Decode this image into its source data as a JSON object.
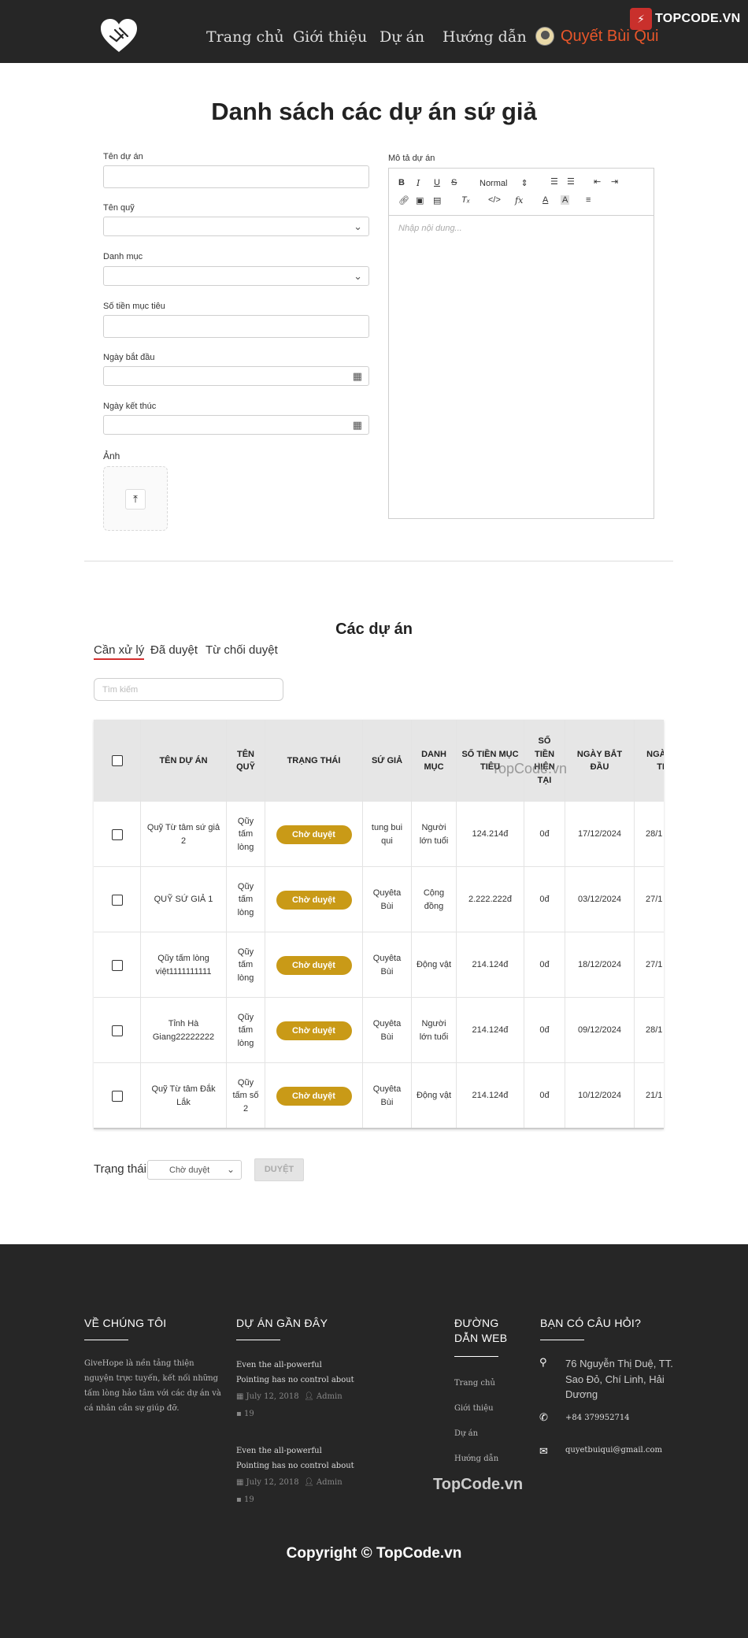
{
  "header": {
    "nav": [
      "Trang chủ",
      "Giới thiệu",
      "Dự án",
      "Hướng dẫn"
    ],
    "user_name": "Quyết Bùi Qui",
    "watermark": "TOPCODE.VN"
  },
  "form": {
    "title": "Danh sách các dự án sứ giả",
    "labels": {
      "name": "Tên dự án",
      "fund": "Tên quỹ",
      "category": "Danh mục",
      "target": "Số tiền mục tiêu",
      "start_date": "Ngày bắt đầu",
      "end_date": "Ngày kết thúc",
      "image": "Ảnh",
      "description": "Mô tả dự án"
    },
    "editor": {
      "heading_select": "Normal",
      "placeholder": "Nhập nội dung..."
    }
  },
  "projects": {
    "title": "Các dự án",
    "tabs": [
      "Cần xử lý",
      "Đã duyệt",
      "Từ chối duyệt"
    ],
    "search_placeholder": "Tìm kiếm",
    "columns": [
      "TÊN DỰ ÁN",
      "TÊN QUỸ",
      "TRẠNG THÁI",
      "SỨ GIẢ",
      "DANH MỤC",
      "SỐ TIỀN MỤC TIÊU",
      "SỐ TIỀN HIỆN TẠI",
      "NGÀY BẮT ĐẦU",
      "NGÀY KẾT THÚC"
    ],
    "rows": [
      {
        "name": "Quỹ Từ tâm sứ giả 2",
        "fund": "Qũy tấm lòng",
        "status": "Chờ duyệt",
        "envoy": "tung bui qui",
        "category": "Người lớn tuổi",
        "target": "124.214đ",
        "current": "0đ",
        "start": "17/12/2024",
        "end": "28/1"
      },
      {
        "name": "QUỸ SỨ GIẢ 1",
        "fund": "Qũy tấm lòng",
        "status": "Chờ duyệt",
        "envoy": "Quyêta Bùi",
        "category": "Cộng đồng",
        "target": "2.222.222đ",
        "current": "0đ",
        "start": "03/12/2024",
        "end": "27/1"
      },
      {
        "name": "Qũy tấm lòng việt1111111111",
        "fund": "Qũy tấm lòng",
        "status": "Chờ duyệt",
        "envoy": "Quyêta Bùi",
        "category": "Động vật",
        "target": "214.124đ",
        "current": "0đ",
        "start": "18/12/2024",
        "end": "27/1"
      },
      {
        "name": "Tỉnh Hà Giang22222222",
        "fund": "Qũy tấm lòng",
        "status": "Chờ duyệt",
        "envoy": "Quyêta Bùi",
        "category": "Người lớn tuổi",
        "target": "214.124đ",
        "current": "0đ",
        "start": "09/12/2024",
        "end": "28/1"
      },
      {
        "name": "Quỹ Từ tâm Đắk Lắk",
        "fund": "Qũy tấm số 2",
        "status": "Chờ duyệt",
        "envoy": "Quyêta Bùi",
        "category": "Động vật",
        "target": "214.124đ",
        "current": "0đ",
        "start": "10/12/2024",
        "end": "21/1"
      }
    ],
    "watermark": "TopCode.vn",
    "status_label": "Trạng thái",
    "status_value": "Chờ duyệt",
    "approve_label": "DUYỆT"
  },
  "footer": {
    "about_title": "VỀ CHÚNG TÔI",
    "about_text": "GiveHope là nền tảng thiện nguyện trực tuyến, kết nối những tấm lòng hảo tâm với các dự án và cá nhân cần sự giúp đỡ.",
    "recent_title": "DỰ ÁN GẦN ĐÂY",
    "posts": [
      {
        "title": "Even the all-powerful Pointing has no control about",
        "date": "July 12, 2018",
        "author": "Admin",
        "comments": "19"
      },
      {
        "title": "Even the all-powerful Pointing has no control about",
        "date": "July 12, 2018",
        "author": "Admin",
        "comments": "19"
      }
    ],
    "guide_title": "ĐƯỜNG DẪN WEB",
    "links": [
      "Trang chủ",
      "Giới thiệu",
      "Dự án",
      "Hướng dẫn"
    ],
    "contact_title": "BẠN CÓ CÂU HỎI?",
    "address": "76 Nguyễn Thị Duệ, TT. Sao Đỏ, Chí Linh, Hải Dương",
    "phone": "+84 379952714",
    "email": "quyetbuiqui@gmail.com",
    "watermark": "TopCode.vn",
    "copyright": "Copyright © TopCode.vn"
  }
}
